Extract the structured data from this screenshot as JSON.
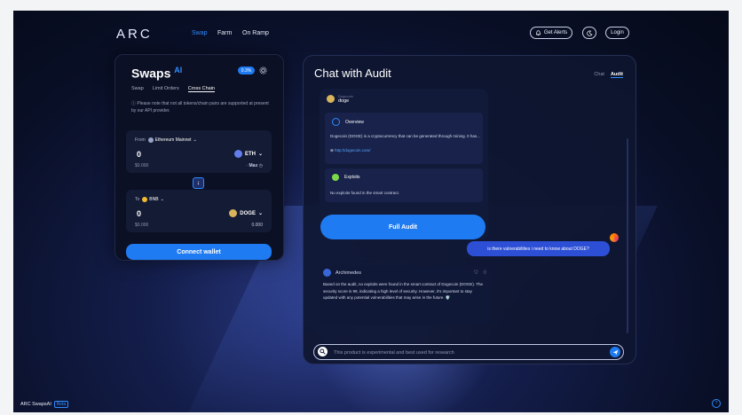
{
  "nav": {
    "logo": "ARC",
    "links": [
      "Swap",
      "Farm",
      "On Ramp"
    ],
    "alerts_label": "Get Alerts",
    "login_label": "Login"
  },
  "swap": {
    "title": "Swaps",
    "title_suffix": "AI",
    "slippage": "0.3%",
    "tabs": [
      "Swap",
      "Limit Orders",
      "Cross Chain"
    ],
    "note": "Please note that not all tokens/chain pairs are supported at present by our API provider.",
    "from": {
      "label": "From",
      "network": "Ethereum Mainnet",
      "amount": "0",
      "usd": "$0.000",
      "token": "ETH",
      "max_label": "Max"
    },
    "to": {
      "label": "To",
      "network": "BNB",
      "amount": "0",
      "usd": "$0.000",
      "token": "DOGE",
      "balance": "0.000"
    },
    "connect_label": "Connect wallet"
  },
  "chat": {
    "title": "Chat with Audit",
    "tabs": [
      "Chat",
      "Audit"
    ],
    "token_name_small": "Dogecoin",
    "token_name": "doge",
    "overview_title": "Overview",
    "overview_text": "Dogecoin (DOGE) is a cryptocurrency that can be generated through mining. It has...",
    "overview_link": "http://dogecoin.com/",
    "exploits_title": "Exploits",
    "exploits_text": "No exploits found in the smart contract.",
    "full_audit_label": "Full Audit",
    "user_message": "is there vulnerabilities i need to know about DOGE?",
    "bot_name": "Archimedes",
    "bot_message": "Based on the audit, no exploits were found in the smart contract of Dogecoin (DOGE). The security score is 99, indicating a high level of security. However, it's important to stay updated with any potential vulnerabilities that may arise in the future. 🛡️",
    "input_placeholder": "This product is experimental and best used for research"
  },
  "footer": {
    "brand": "ARC SwapsAI",
    "beta": "Beta"
  },
  "colors": {
    "accent": "#1f7bf2",
    "background": "#090f26"
  }
}
